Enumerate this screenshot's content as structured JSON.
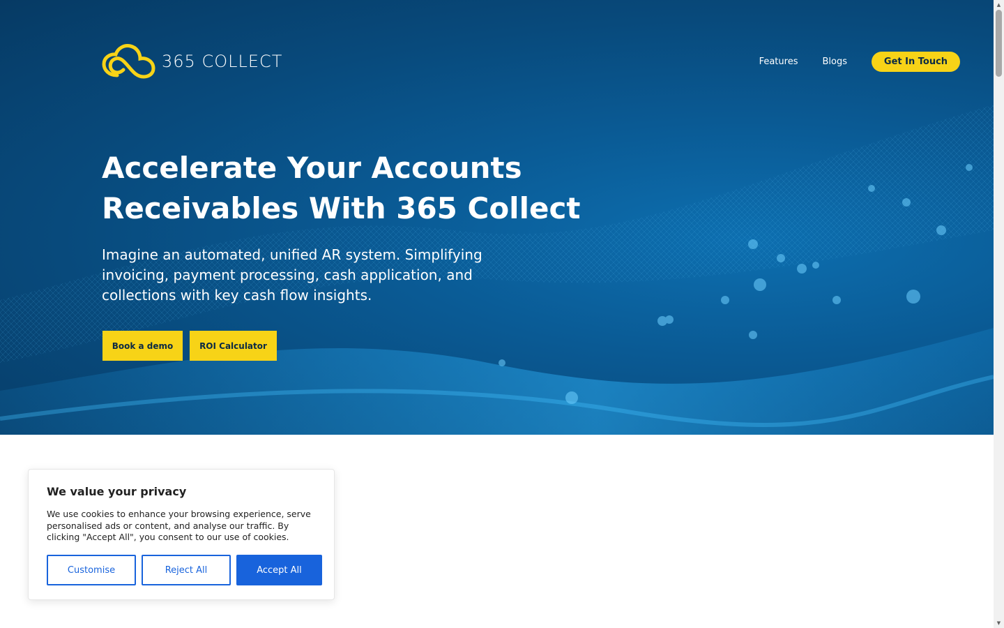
{
  "brand": {
    "name": "365 COLLECT",
    "accent": "#f7d317",
    "hero_bg": "#084a7c",
    "logo_icon": "cloud-infinity-icon"
  },
  "nav": {
    "items": [
      {
        "label": "Features"
      },
      {
        "label": "Blogs"
      }
    ],
    "cta_label": "Get In Touch"
  },
  "hero": {
    "title_line1": "Accelerate Your Accounts",
    "title_line2": "Receivables With 365 Collect",
    "subtitle": "Imagine an automated, unified AR system. Simplifying invoicing, payment processing, cash application, and collections with key cash flow insights.",
    "buttons": {
      "demo": "Book a demo",
      "roi": "ROI Calculator"
    }
  },
  "cookie_banner": {
    "title": "We value your privacy",
    "text": "We use cookies to enhance your browsing experience, serve personalised ads or content, and analyse our traffic. By clicking \"Accept All\", you consent to our use of cookies.",
    "customise_label": "Customise",
    "reject_label": "Reject All",
    "accept_label": "Accept All",
    "button_color": "#1863dc"
  }
}
